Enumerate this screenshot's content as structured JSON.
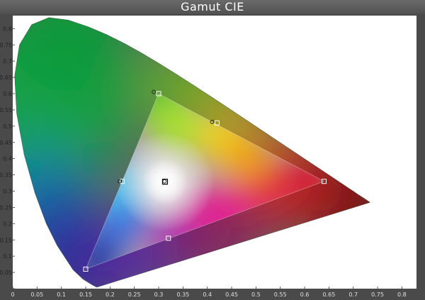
{
  "title": "Gamut CIE",
  "chart_data": {
    "type": "scatter",
    "title": "Gamut CIE",
    "xlabel": "",
    "ylabel": "",
    "xlim": [
      0,
      0.83
    ],
    "ylim": [
      0,
      0.84
    ],
    "x_ticks": [
      "0",
      "0.05",
      "0.1",
      "0.15",
      "0.2",
      "0.25",
      "0.3",
      "0.35",
      "0.4",
      "0.45",
      "0.5",
      "0.55",
      "0.6",
      "0.65",
      "0.7",
      "0.75",
      "0.8"
    ],
    "y_ticks": [
      "0",
      "0.05",
      "0.1",
      "0.15",
      "0.2",
      "0.25",
      "0.3",
      "0.35",
      "0.4",
      "0.45",
      "0.5",
      "0.55",
      "0.6",
      "0.65",
      "0.7",
      "0.75",
      "0.8"
    ],
    "grid": false,
    "reference_gamut": [
      {
        "x": 0.64,
        "y": 0.33
      },
      {
        "x": 0.3,
        "y": 0.6
      },
      {
        "x": 0.15,
        "y": 0.06
      }
    ],
    "measured_points": [
      {
        "x": 0.64,
        "y": 0.33
      },
      {
        "x": 0.42,
        "y": 0.51
      },
      {
        "x": 0.3,
        "y": 0.6
      },
      {
        "x": 0.225,
        "y": 0.33
      },
      {
        "x": 0.15,
        "y": 0.06
      },
      {
        "x": 0.32,
        "y": 0.155
      },
      {
        "x": 0.313,
        "y": 0.329
      }
    ],
    "target_points": [
      {
        "x": 0.29,
        "y": 0.605
      },
      {
        "x": 0.41,
        "y": 0.513
      },
      {
        "x": 0.22,
        "y": 0.33
      },
      {
        "x": 0.312,
        "y": 0.33
      }
    ],
    "spectral_locus": [
      [
        0.1741,
        0.005
      ],
      [
        0.1738,
        0.0049
      ],
      [
        0.1733,
        0.0048
      ],
      [
        0.1726,
        0.0048
      ],
      [
        0.1714,
        0.0051
      ],
      [
        0.1689,
        0.0069
      ],
      [
        0.1644,
        0.0109
      ],
      [
        0.1566,
        0.0177
      ],
      [
        0.144,
        0.0297
      ],
      [
        0.1241,
        0.0578
      ],
      [
        0.0913,
        0.1327
      ],
      [
        0.0687,
        0.2007
      ],
      [
        0.0454,
        0.295
      ],
      [
        0.0235,
        0.4127
      ],
      [
        0.0082,
        0.5384
      ],
      [
        0.0039,
        0.6548
      ],
      [
        0.0139,
        0.7502
      ],
      [
        0.0389,
        0.812
      ],
      [
        0.0743,
        0.8338
      ],
      [
        0.1142,
        0.8262
      ],
      [
        0.1547,
        0.8059
      ],
      [
        0.1929,
        0.7816
      ],
      [
        0.2296,
        0.7543
      ],
      [
        0.2658,
        0.7243
      ],
      [
        0.3016,
        0.6923
      ],
      [
        0.3373,
        0.6589
      ],
      [
        0.3731,
        0.6245
      ],
      [
        0.4087,
        0.5896
      ],
      [
        0.4441,
        0.5547
      ],
      [
        0.4788,
        0.5202
      ],
      [
        0.5125,
        0.4866
      ],
      [
        0.5448,
        0.4544
      ],
      [
        0.5752,
        0.4242
      ],
      [
        0.6029,
        0.3965
      ],
      [
        0.627,
        0.3725
      ],
      [
        0.6482,
        0.3514
      ],
      [
        0.6658,
        0.334
      ],
      [
        0.6801,
        0.3197
      ],
      [
        0.6915,
        0.3083
      ],
      [
        0.7006,
        0.2993
      ],
      [
        0.7079,
        0.292
      ],
      [
        0.714,
        0.2859
      ],
      [
        0.719,
        0.2809
      ],
      [
        0.723,
        0.277
      ],
      [
        0.726,
        0.274
      ],
      [
        0.7283,
        0.2717
      ],
      [
        0.73,
        0.27
      ],
      [
        0.7311,
        0.2689
      ],
      [
        0.732,
        0.268
      ],
      [
        0.7327,
        0.2673
      ],
      [
        0.7334,
        0.2666
      ],
      [
        0.734,
        0.266
      ],
      [
        0.7344,
        0.2656
      ],
      [
        0.7346,
        0.2654
      ],
      [
        0.7347,
        0.2653
      ]
    ],
    "colors": {
      "red": "#cc1a2a",
      "green": "#1a9a40",
      "blue": "#1a2aa0",
      "white_point": "#ffffff",
      "plot_background": "#ffffff",
      "frame": "#4a4a4a",
      "marker_stroke": "#444444"
    }
  }
}
